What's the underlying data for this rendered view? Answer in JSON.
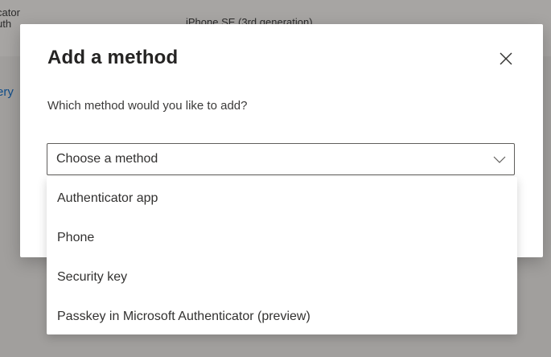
{
  "background": {
    "fragment1": "cator",
    "fragment2": "uth",
    "device": "iPhone SE (3rd generation)",
    "link_fragment": "ery"
  },
  "dialog": {
    "title": "Add a method",
    "prompt": "Which method would you like to add?",
    "close_icon": "close-icon"
  },
  "select": {
    "value": "Choose a method",
    "chevron_icon": "chevron-down-icon",
    "options": [
      "Authenticator app",
      "Phone",
      "Security key",
      "Passkey in Microsoft Authenticator (preview)"
    ]
  },
  "colors": {
    "overlay": "#a19f9d",
    "dialog_bg": "#ffffff",
    "text": "#323130",
    "link": "#0f4d8a"
  }
}
